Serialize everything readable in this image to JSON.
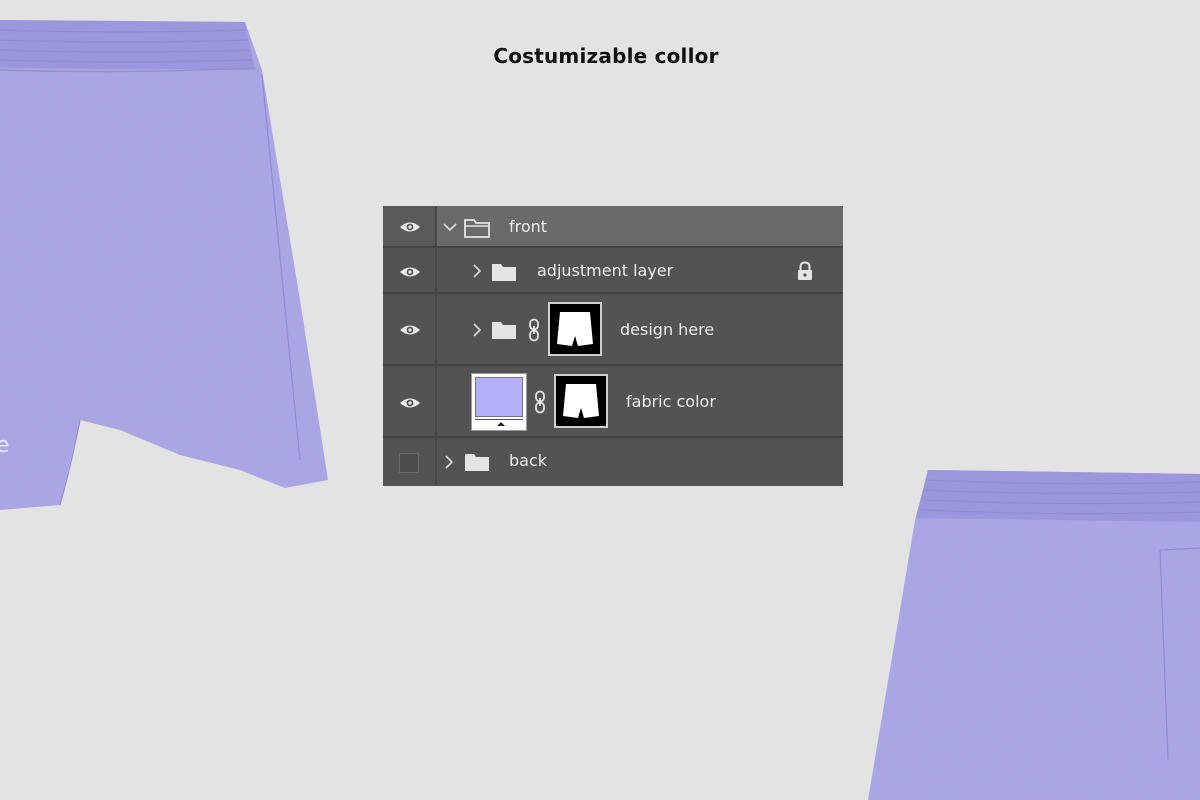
{
  "heading": "Costumizable collor",
  "colors": {
    "fabric": "#a6a3e3",
    "fabric_dark": "#8f8cd2",
    "swatch": "#b3b0fb",
    "background": "#e3e3e3",
    "panel": "#535353",
    "panel_selected": "#6a6a6a"
  },
  "layers_panel": {
    "layers": [
      {
        "name": "front",
        "visible": true,
        "type": "group",
        "expanded": true,
        "selected": true
      },
      {
        "name": "adjustment layer",
        "visible": true,
        "type": "group",
        "expanded": false,
        "locked": true
      },
      {
        "name": "design here",
        "visible": true,
        "type": "group",
        "expanded": false,
        "linked_mask": true
      },
      {
        "name": "fabric color",
        "visible": true,
        "type": "color-fill",
        "linked_mask": true
      },
      {
        "name": "back",
        "visible": false,
        "type": "group",
        "expanded": false
      }
    ]
  }
}
